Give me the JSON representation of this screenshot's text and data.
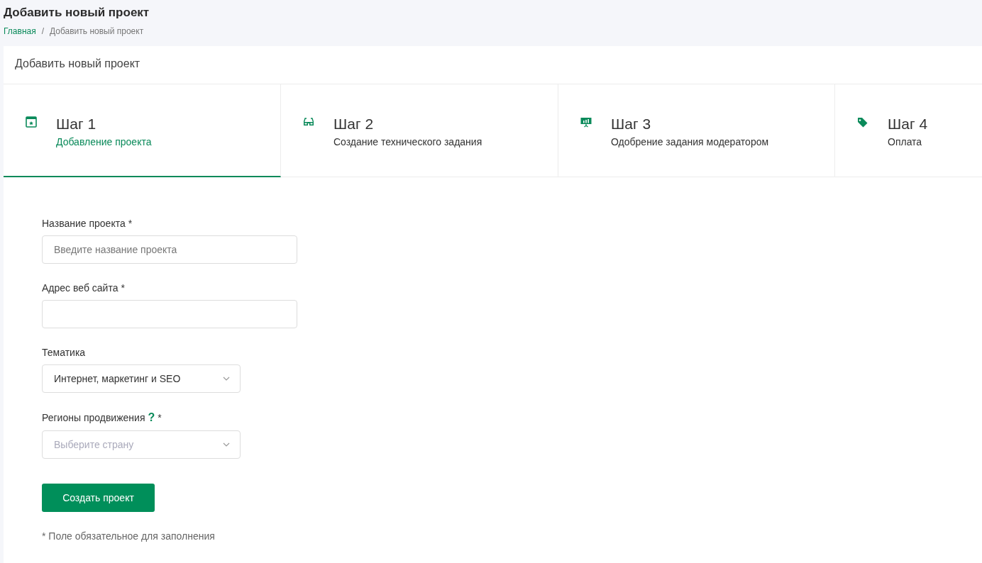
{
  "page": {
    "title": "Добавить новый проект"
  },
  "breadcrumb": [
    {
      "label": "Главная",
      "link": true
    },
    {
      "label": "Добавить новый проект",
      "link": false
    }
  ],
  "breadcrumb_separator": "/",
  "card": {
    "title": "Добавить новый проект"
  },
  "steps": [
    {
      "title": "Шаг 1",
      "subtitle": "Добавление проекта",
      "selected": true
    },
    {
      "title": "Шаг 2",
      "subtitle": "Создание технического задания",
      "selected": false
    },
    {
      "title": "Шаг 3",
      "subtitle": "Одобрение задания модератором",
      "selected": false
    },
    {
      "title": "Шаг 4",
      "subtitle": "Оплата",
      "selected": false
    }
  ],
  "form": {
    "fields": [
      {
        "kind": "text",
        "label": "Название проекта",
        "required_mark": "*",
        "placeholder": "Введите название проекта"
      },
      {
        "kind": "text",
        "label": "Адрес веб сайта",
        "required_mark": "*"
      },
      {
        "kind": "select",
        "label": "Тематика",
        "value": "Интернет, маркетинг и SEO"
      },
      {
        "kind": "select",
        "label": "Регионы продвижения",
        "help": "?",
        "required_mark": "*",
        "placeholder": "Выберите страну"
      }
    ],
    "submit": "Создать проект",
    "note": "* Поле обязательное для заполнения"
  }
}
